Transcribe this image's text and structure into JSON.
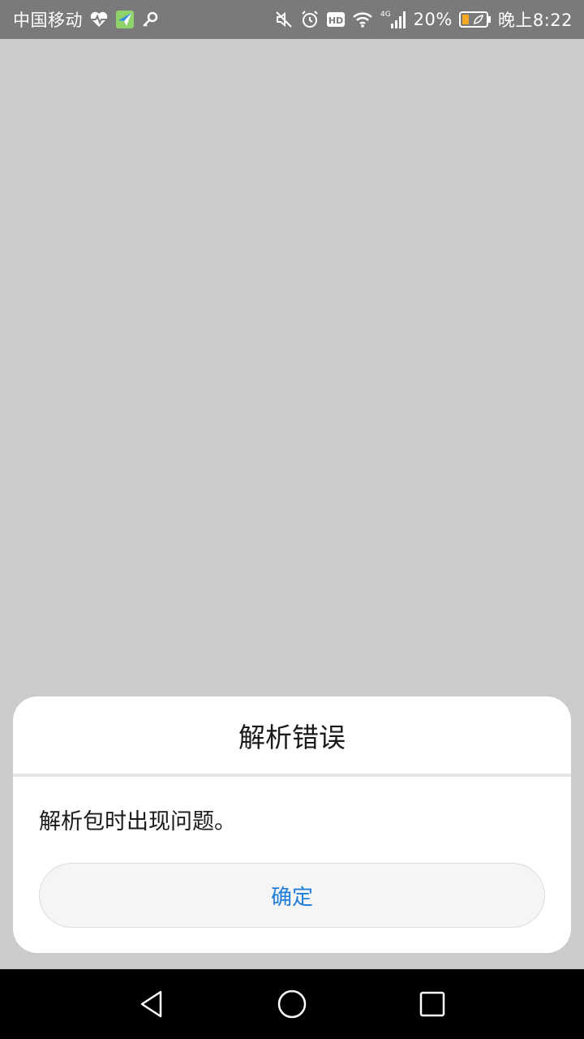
{
  "status_bar": {
    "carrier": "中国移动",
    "network_label": "4G",
    "battery_percent": "20%",
    "time": "晚上8:22",
    "icons": [
      "heart-rate-icon",
      "app-notification-icon",
      "key-icon",
      "mute-icon",
      "alarm-icon",
      "hd-icon",
      "wifi-icon",
      "signal-icon",
      "battery-icon"
    ]
  },
  "dialog": {
    "title": "解析错误",
    "message": "解析包时出现问题。",
    "confirm_label": "确定"
  },
  "nav_bar": {
    "buttons": [
      "back-icon",
      "home-icon",
      "recents-icon"
    ]
  },
  "colors": {
    "status_bar_bg": "#7a7a7a",
    "background": "#cbcbcb",
    "dialog_bg": "#ffffff",
    "accent": "#1f7ddb",
    "nav_bar_bg": "#000000"
  }
}
